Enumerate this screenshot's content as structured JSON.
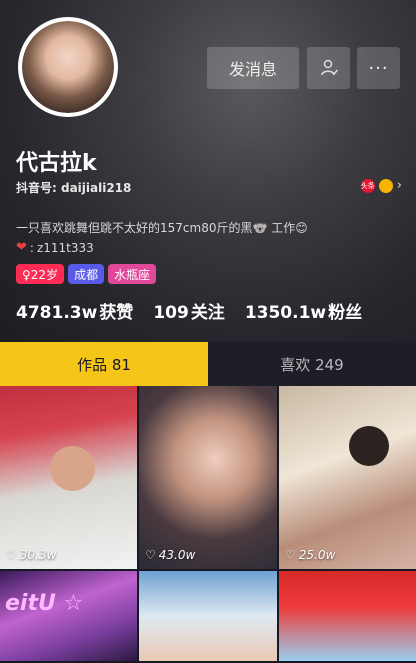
{
  "profile": {
    "follow_message_label": "发消息",
    "more_label": "···",
    "name": "代古拉k",
    "id_label": "抖音号: daijiali218",
    "weibo_badge": "头条",
    "bio_line1": "一只喜欢跳舞但跳不太好的157cm80斤的黑🐨 工作😊",
    "bio_line2": "z111t333",
    "tags": [
      {
        "label": "♀22岁"
      },
      {
        "label": "成都"
      },
      {
        "label": "水瓶座"
      }
    ],
    "stats": {
      "likes_num": "4781.3w",
      "likes_label": "获赞",
      "following_num": "109",
      "following_label": "关注",
      "followers_num": "1350.1w",
      "followers_label": "粉丝"
    }
  },
  "tabs": {
    "works": "作品 81",
    "liked": "喜欢 249"
  },
  "videos": [
    {
      "likes": "30.3w"
    },
    {
      "likes": "43.0w"
    },
    {
      "likes": "25.0w"
    },
    {
      "likes": ""
    },
    {
      "likes": ""
    },
    {
      "likes": ""
    }
  ],
  "colors": {
    "accent": "#f5c518",
    "background": "#161823",
    "tag_age": "#fe2c55",
    "tag_city": "#5a5ae8",
    "tag_star": "#e2489a"
  }
}
